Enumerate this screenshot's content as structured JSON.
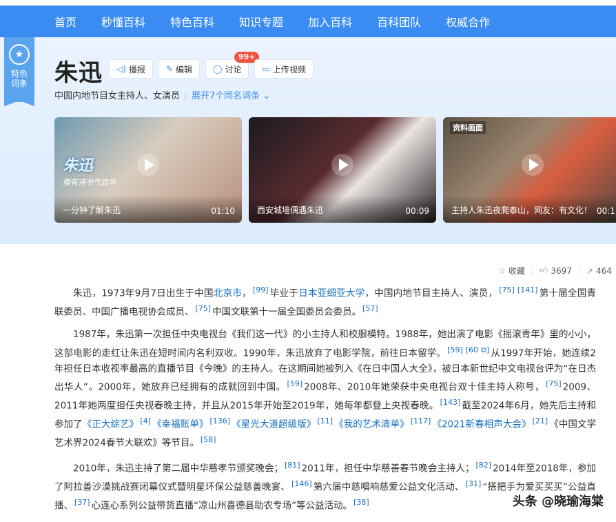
{
  "nav": {
    "items": [
      {
        "label": "首页"
      },
      {
        "label": "秒懂百科"
      },
      {
        "label": "特色百科"
      },
      {
        "label": "知识专题"
      },
      {
        "label": "加入百科"
      },
      {
        "label": "百科团队"
      },
      {
        "label": "权威合作"
      }
    ]
  },
  "ribbon": {
    "text": "特色词条",
    "icon": "badge-icon"
  },
  "entry": {
    "title": "朱迅",
    "subtitle": "中国内地节目女主持人、女演员",
    "same_name_link": "展开7个同名词条",
    "actions": {
      "broadcast": "播报",
      "edit": "编辑",
      "discuss": "讨论",
      "discuss_badge": "99+",
      "upload_video": "上传视频"
    }
  },
  "videos": [
    {
      "caption": "一分钟了解朱迅",
      "duration": "01:10",
      "overlay_name": "朱迅",
      "overlay_tag": "腹有诗书气自华"
    },
    {
      "caption": "西安城墙偶遇朱迅",
      "duration": "00:09"
    },
    {
      "caption": "主持人朱迅夜爬泰山，网友：有文化！",
      "duration": "00:1",
      "overlay_label": "资料画面"
    }
  ],
  "stats": {
    "collect_label": "收藏",
    "likes": "3697",
    "shares": "464"
  },
  "paragraphs": {
    "p1": {
      "t1": "朱迅，1973年9月7日出生于中国",
      "l1": "北京市",
      "t2": "，",
      "r1": "[99]",
      "t3": "毕业于",
      "l2": "日本亚细亚大学",
      "t4": "，中国内地节目主持人、演员，",
      "r2": "[75]",
      "r3": "[141]",
      "t5": "第十届全国青联委员、中国广播电视协会成员、",
      "r4": "[75]",
      "t6": "中国文联第十一届全国委员会委员。",
      "r5": "[57]"
    },
    "p2": {
      "t1": "1987年，朱迅第一次担任中央电视台《我们这一代》的小主持人和校服模特。1988年，她出演了电影《摇滚青年》里的小小，这部电影的走红让朱迅在短时间内名利双收。1990年，朱迅放弃了电影学院，前往日本留学。",
      "r1": "[59]",
      "r2": "[60",
      "t2": "从1997年开始，她连续2年担任日本收视率最高的直播节目《今晚》的主持人。在这期间她被列入《在日中国人大全》，被日本新世纪中文电视台评为“在日杰出华人”。2000年，她放弃已经拥有的成就回到中国。",
      "r3": "[59]",
      "t3": "2008年、2010年她荣获中央电视台双十佳主持人称号，",
      "r4": "[75]",
      "t4": "2009、2011年她两度担任央视春晚主持，并且从2015年开始至2019年，她每年都登上央视春晚。",
      "r5": "[143]",
      "t5": "截至2024年6月，她先后主持和参加了",
      "l1": "《正大综艺》",
      "r6": "[4]",
      "l2": "《幸福账单》",
      "r7": "[136]",
      "l3": "《星光大道超级版》",
      "r8": "[11]",
      "l4": "《我的艺术清单》",
      "r9": "[117]",
      "l5": "《2021新春相声大会》",
      "r10": "[21]",
      "t6": "《中国文学艺术界2024春节大联欢》等节目。",
      "r11": "[58]"
    },
    "p3": {
      "t1": "2010年，朱迅主持了第二届中华慈孝节颁奖晚会；",
      "r1": "[81]",
      "t2": "2011年，担任中华慈善春节晚会主持人；",
      "r2": "[82]",
      "t3": "2014年至2018年，参加了阿拉善沙漠挑战赛闭幕仪式暨明星环保公益慈善晚宴、",
      "r3": "[146]",
      "t4": "第六届中慈唱响慈爱公益文化活动、",
      "r4": "[31]",
      "t5": "“搭把手为爱买买买”公益直播、",
      "r5": "[37]",
      "t6": "心连心系列公益带货直播“凉山州喜德县助农专场”等公益活动。",
      "r6": "[38]"
    }
  },
  "watermark": "头条 @晓瑜海棠",
  "colors": {
    "nav_bg": "#3a8cf2",
    "link": "#136ec2",
    "badge": "#f3513f"
  }
}
